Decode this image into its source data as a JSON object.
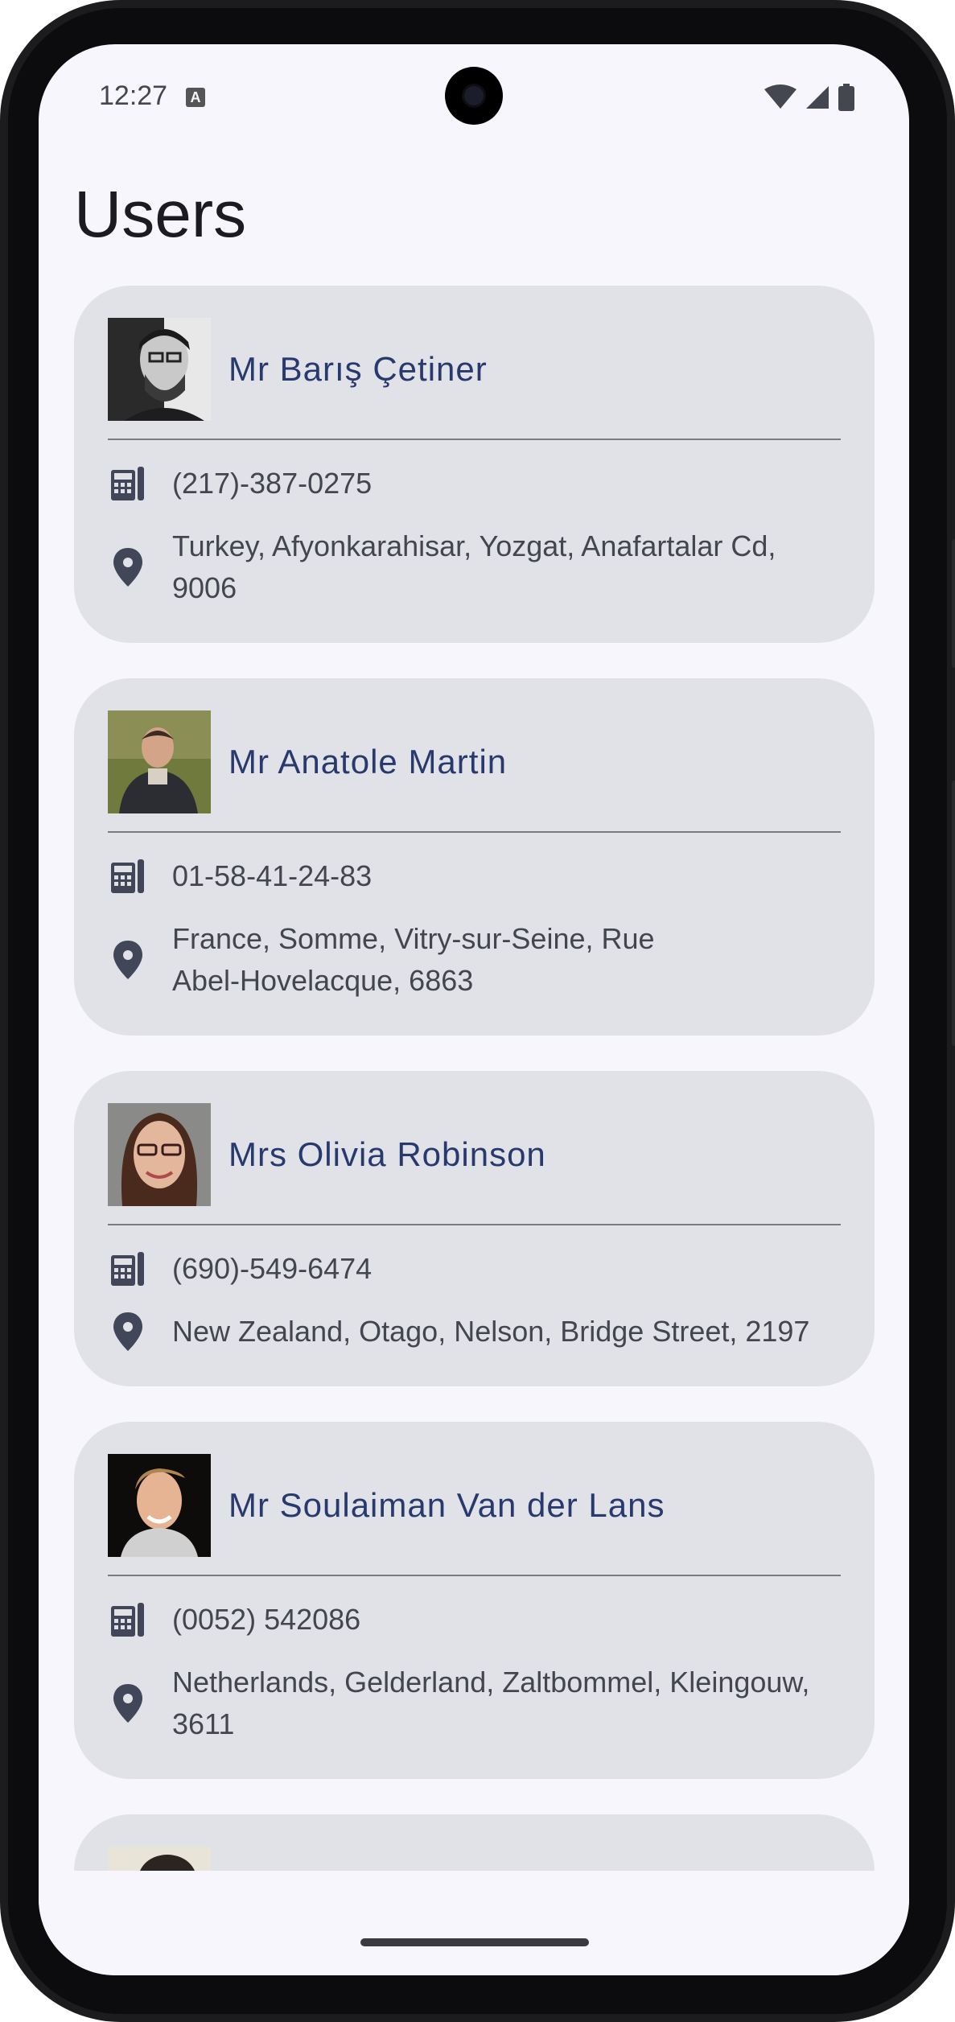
{
  "status_bar": {
    "time": "12:27",
    "badge": "A",
    "icons": [
      "wifi-icon",
      "cellular-signal-icon",
      "battery-icon"
    ]
  },
  "header": {
    "title": "Users"
  },
  "users": [
    {
      "name": "Mr Barış Çetiner",
      "phone": "(217)-387-0275",
      "address_line1": "Turkey, Afyonkarahisar, Yozgat, Anafartalar Cd,",
      "address_line2": "9006"
    },
    {
      "name": "Mr Anatole Martin",
      "phone": "01-58-41-24-83",
      "address_line1": "France, Somme, Vitry-sur-Seine, Rue",
      "address_line2": "Abel-Hovelacque, 6863"
    },
    {
      "name": "Mrs Olivia Robinson",
      "phone": "(690)-549-6474",
      "address_line1": "New Zealand, Otago, Nelson, Bridge Street, 2197",
      "address_line2": ""
    },
    {
      "name": "Mr Soulaiman Van der Lans",
      "phone": "(0052) 542086",
      "address_line1": "Netherlands, Gelderland, Zaltbommel, Kleingouw,",
      "address_line2": "3611"
    }
  ],
  "colors": {
    "background": "#f7f6fc",
    "card": "#e1e2e8",
    "name_text": "#27396d",
    "body_text": "#44464f",
    "icon": "#424659"
  },
  "icons": {
    "phone": "phone-icon",
    "location": "location-pin-icon"
  }
}
